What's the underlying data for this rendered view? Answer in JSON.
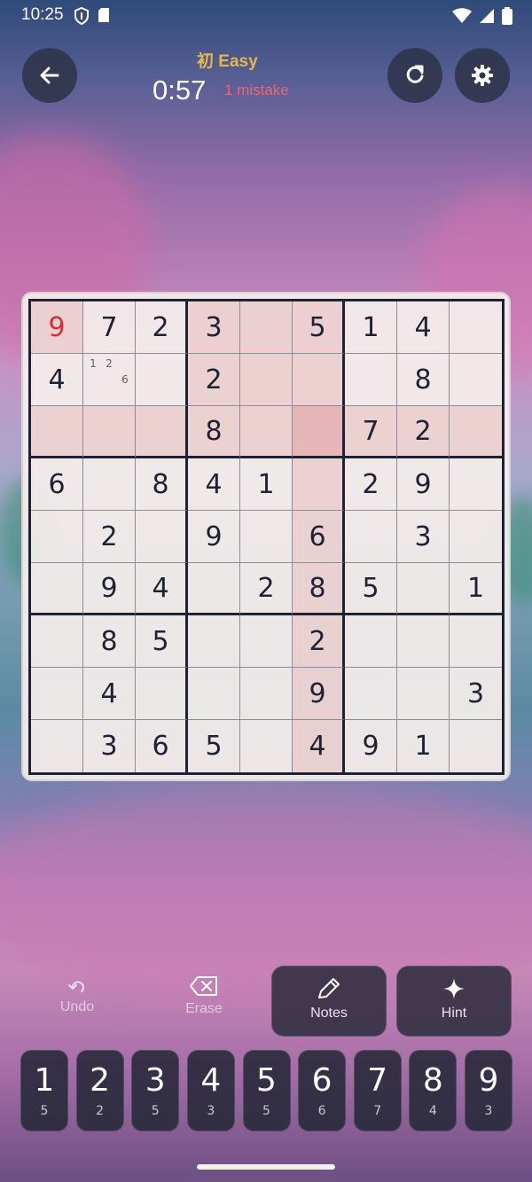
{
  "status_bar": {
    "time": "10:25"
  },
  "header": {
    "difficulty_label": "初 Easy",
    "timer": "0:57",
    "mistakes": "1 mistake"
  },
  "colors": {
    "accent_gold": "#e6b84a",
    "error_red": "#d2313b",
    "mistake_text": "#e46a78",
    "grid_dark": "#1f2233"
  },
  "board": {
    "rows": [
      [
        "9",
        "7",
        "2",
        "3",
        "",
        "5",
        "1",
        "4",
        ""
      ],
      [
        "4",
        "",
        "",
        "2",
        "",
        "",
        "",
        "8",
        ""
      ],
      [
        "",
        "",
        "",
        "8",
        "",
        "",
        "7",
        "2",
        ""
      ],
      [
        "6",
        "",
        "8",
        "4",
        "1",
        "",
        "2",
        "9",
        ""
      ],
      [
        "",
        "2",
        "",
        "9",
        "",
        "6",
        "",
        "3",
        ""
      ],
      [
        "",
        "9",
        "4",
        "",
        "2",
        "8",
        "5",
        "",
        "1"
      ],
      [
        "",
        "8",
        "5",
        "",
        "",
        "2",
        "",
        "",
        ""
      ],
      [
        "",
        "4",
        "",
        "",
        "",
        "9",
        "",
        "",
        "3"
      ],
      [
        "",
        "3",
        "6",
        "5",
        "",
        "4",
        "9",
        "1",
        ""
      ]
    ],
    "notes": {
      "r1c1": [
        "1",
        "2",
        "",
        "",
        "",
        "6",
        "",
        "",
        ""
      ]
    },
    "error_cell": "r0c0",
    "selected_cell": "r2c5"
  },
  "actions": {
    "undo": "Undo",
    "erase": "Erase",
    "notes": "Notes",
    "hint": "Hint"
  },
  "numpad": [
    {
      "digit": "1",
      "count": "5"
    },
    {
      "digit": "2",
      "count": "2"
    },
    {
      "digit": "3",
      "count": "5"
    },
    {
      "digit": "4",
      "count": "3"
    },
    {
      "digit": "5",
      "count": "5"
    },
    {
      "digit": "6",
      "count": "6"
    },
    {
      "digit": "7",
      "count": "7"
    },
    {
      "digit": "8",
      "count": "4"
    },
    {
      "digit": "9",
      "count": "3"
    }
  ]
}
